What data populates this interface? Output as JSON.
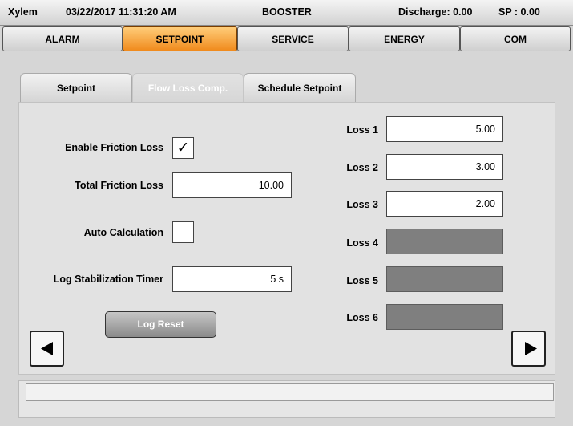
{
  "header": {
    "brand": "Xylem",
    "datetime": "03/22/2017 11:31:20 AM",
    "mode": "BOOSTER",
    "discharge": "Discharge: 0.00",
    "sp": "SP : 0.00"
  },
  "nav": {
    "items": [
      "ALARM",
      "SETPOINT",
      "SERVICE",
      "ENERGY",
      "COM"
    ],
    "active": "SETPOINT",
    "active_color": "#f5a33f"
  },
  "tabs": {
    "items": [
      "Setpoint",
      "Flow Loss Comp.",
      "Schedule Setpoint"
    ],
    "active": "Setpoint"
  },
  "form": {
    "enable_friction_label": "Enable Friction Loss",
    "enable_friction_checked": true,
    "check_mark": "✓",
    "total_friction_label": "Total Friction Loss",
    "total_friction_value": "10.00",
    "auto_calc_label": "Auto Calculation",
    "auto_calc_checked": false,
    "log_timer_label": "Log Stabilization Timer",
    "log_timer_value": "5 s",
    "log_reset_label": "Log Reset"
  },
  "losses": [
    {
      "label": "Loss 1",
      "value": "5.00",
      "enabled": true
    },
    {
      "label": "Loss 2",
      "value": "3.00",
      "enabled": true
    },
    {
      "label": "Loss 3",
      "value": "2.00",
      "enabled": true
    },
    {
      "label": "Loss 4",
      "value": "",
      "enabled": false
    },
    {
      "label": "Loss 5",
      "value": "",
      "enabled": false
    },
    {
      "label": "Loss 6",
      "value": "",
      "enabled": false
    }
  ],
  "nav_arrows": {
    "left_icon": "triangle-left-icon",
    "right_icon": "triangle-right-icon"
  },
  "status": {
    "message": ""
  }
}
